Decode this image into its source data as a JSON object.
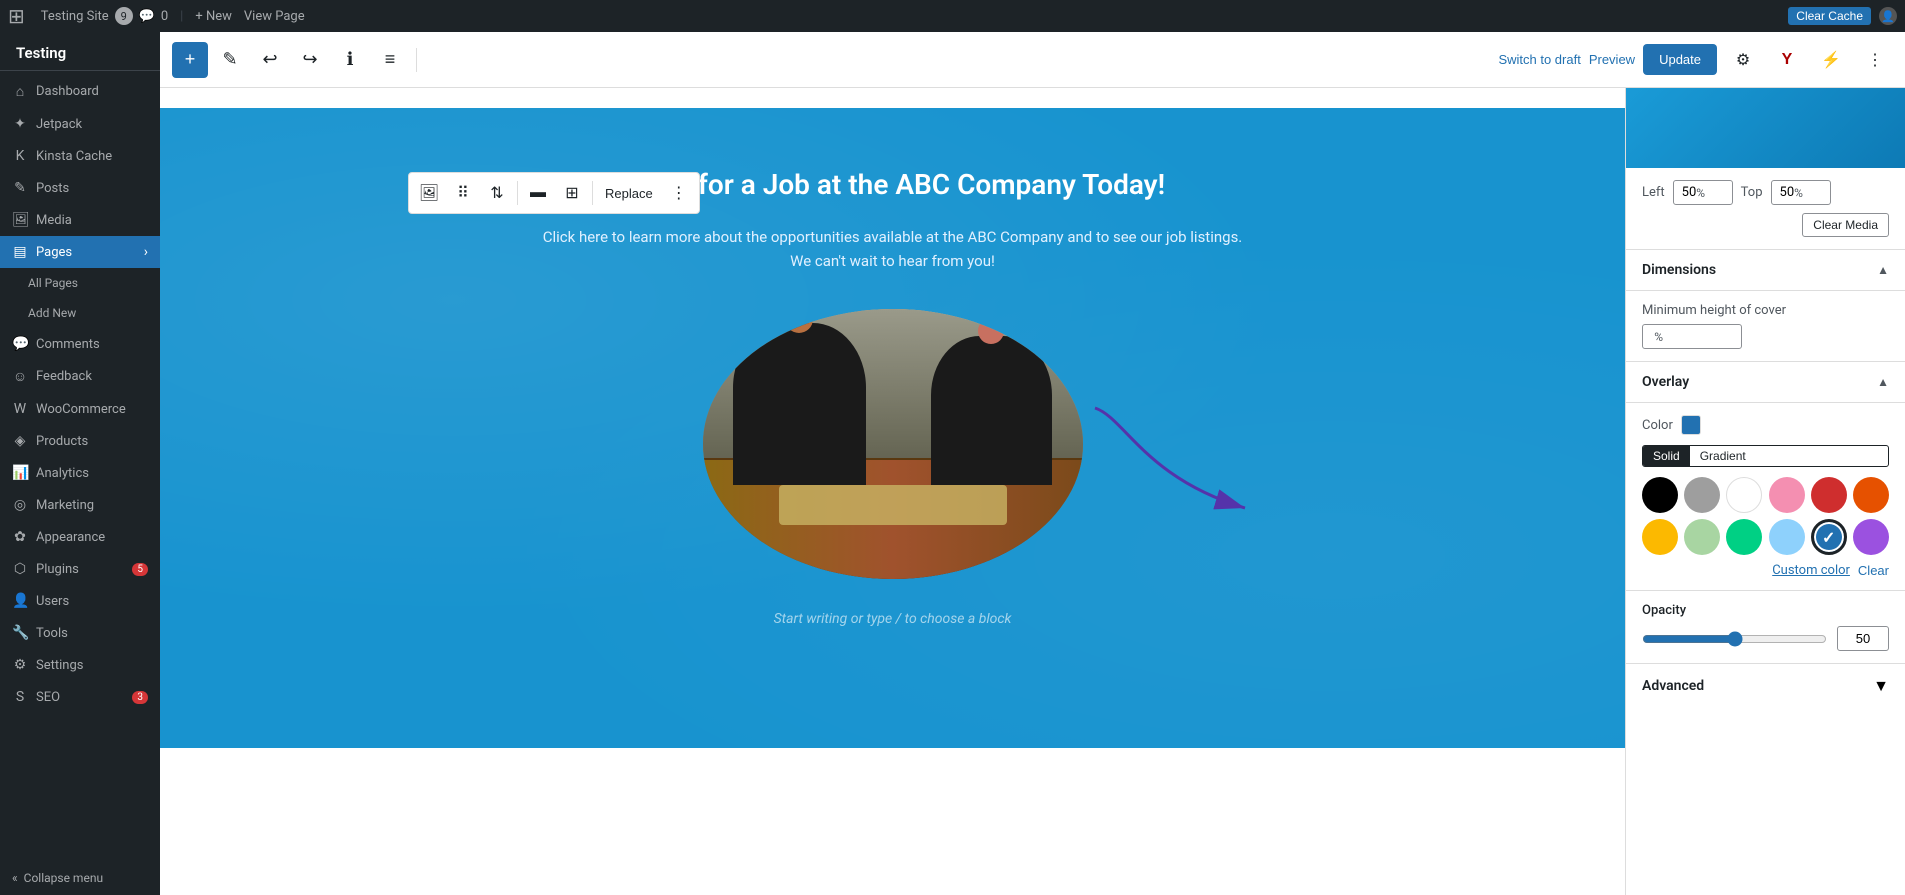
{
  "topbar": {
    "wp_logo": "⊞",
    "site_name": "Testing Site",
    "notif_count": "9",
    "comment_count": "0",
    "new_label": "+ New",
    "view_page_label": "View Page",
    "clear_cache_label": "Clear Cache"
  },
  "sidebar": {
    "site_name": "Testing",
    "items": [
      {
        "id": "dashboard",
        "label": "Dashboard",
        "icon": "⌂"
      },
      {
        "id": "jetpack",
        "label": "Jetpack",
        "icon": "✦"
      },
      {
        "id": "kinsta",
        "label": "Kinsta Cache",
        "icon": "K"
      },
      {
        "id": "posts",
        "label": "Posts",
        "icon": "✎"
      },
      {
        "id": "media",
        "label": "Media",
        "icon": "⬛"
      },
      {
        "id": "pages",
        "label": "Pages",
        "icon": "▤",
        "active": true
      },
      {
        "id": "all-pages",
        "label": "All Pages",
        "sub": true
      },
      {
        "id": "add-new",
        "label": "Add New",
        "sub": true
      },
      {
        "id": "comments",
        "label": "Comments",
        "icon": "💬"
      },
      {
        "id": "feedback",
        "label": "Feedback",
        "icon": "☺"
      },
      {
        "id": "woocommerce",
        "label": "WooCommerce",
        "icon": "W"
      },
      {
        "id": "products",
        "label": "Products",
        "icon": "◈"
      },
      {
        "id": "analytics",
        "label": "Analytics",
        "icon": "📊"
      },
      {
        "id": "marketing",
        "label": "Marketing",
        "icon": "◎"
      },
      {
        "id": "appearance",
        "label": "Appearance",
        "icon": "✿"
      },
      {
        "id": "plugins",
        "label": "Plugins",
        "icon": "⬡",
        "badge": "5"
      },
      {
        "id": "users",
        "label": "Users",
        "icon": "👤"
      },
      {
        "id": "tools",
        "label": "Tools",
        "icon": "🔧"
      },
      {
        "id": "settings",
        "label": "Settings",
        "icon": "⚙"
      },
      {
        "id": "seo",
        "label": "SEO",
        "icon": "S",
        "badge": "3"
      },
      {
        "id": "collapse",
        "label": "Collapse menu",
        "icon": "«"
      }
    ]
  },
  "editor_toolbar": {
    "add_btn": "+",
    "edit_icon": "✎",
    "undo_icon": "↩",
    "redo_icon": "↪",
    "info_icon": "ℹ",
    "list_view_icon": "≡",
    "switch_draft": "Switch to draft",
    "preview": "Preview",
    "update": "Update",
    "settings_icon": "⚙",
    "yoast_icon": "Y",
    "bolt_icon": "⚡",
    "more_icon": "⋮"
  },
  "block_toolbar": {
    "image_icon": "🖼",
    "grid_icon": "⠿",
    "updown_icon": "⇅",
    "align_icon": "▬",
    "fullwide_icon": "⊞",
    "replace_label": "Replace",
    "more_icon": "⋮"
  },
  "cover": {
    "title": "Apply for a Job at the ABC Company Today!",
    "subtitle": "Click here to learn more about the opportunities available at the ABC Company and to see our job listings. We can't wait to hear from you!",
    "placeholder": "Start writing or type / to choose a block"
  },
  "right_panel": {
    "left_label": "Left",
    "top_label": "Top",
    "left_value": "50",
    "top_value": "50",
    "percent": "%",
    "clear_media_label": "Clear Media",
    "dimensions_title": "Dimensions",
    "min_height_label": "Minimum height of cover",
    "overlay_title": "Overlay",
    "color_label": "Color",
    "solid_label": "Solid",
    "gradient_label": "Gradient",
    "colors": [
      {
        "id": "black",
        "hex": "#000000",
        "selected": false
      },
      {
        "id": "gray",
        "hex": "#9e9e9e",
        "selected": false
      },
      {
        "id": "white",
        "hex": "#ffffff",
        "selected": false
      },
      {
        "id": "pink",
        "hex": "#f48fb1",
        "selected": false
      },
      {
        "id": "red",
        "hex": "#cf2e2e",
        "selected": false
      },
      {
        "id": "orange",
        "hex": "#e65100",
        "selected": false
      },
      {
        "id": "yellow",
        "hex": "#fcb900",
        "selected": false
      },
      {
        "id": "light-green",
        "hex": "#a8d5a2",
        "selected": false
      },
      {
        "id": "green",
        "hex": "#00d084",
        "selected": false
      },
      {
        "id": "light-blue",
        "hex": "#8ed1fc",
        "selected": false
      },
      {
        "id": "blue",
        "hex": "#2271b1",
        "selected": true
      },
      {
        "id": "purple",
        "hex": "#9b51e0",
        "selected": false
      }
    ],
    "custom_color_label": "Custom color",
    "clear_label": "Clear",
    "opacity_label": "Opacity",
    "opacity_value": "50",
    "advanced_title": "Advanced"
  }
}
